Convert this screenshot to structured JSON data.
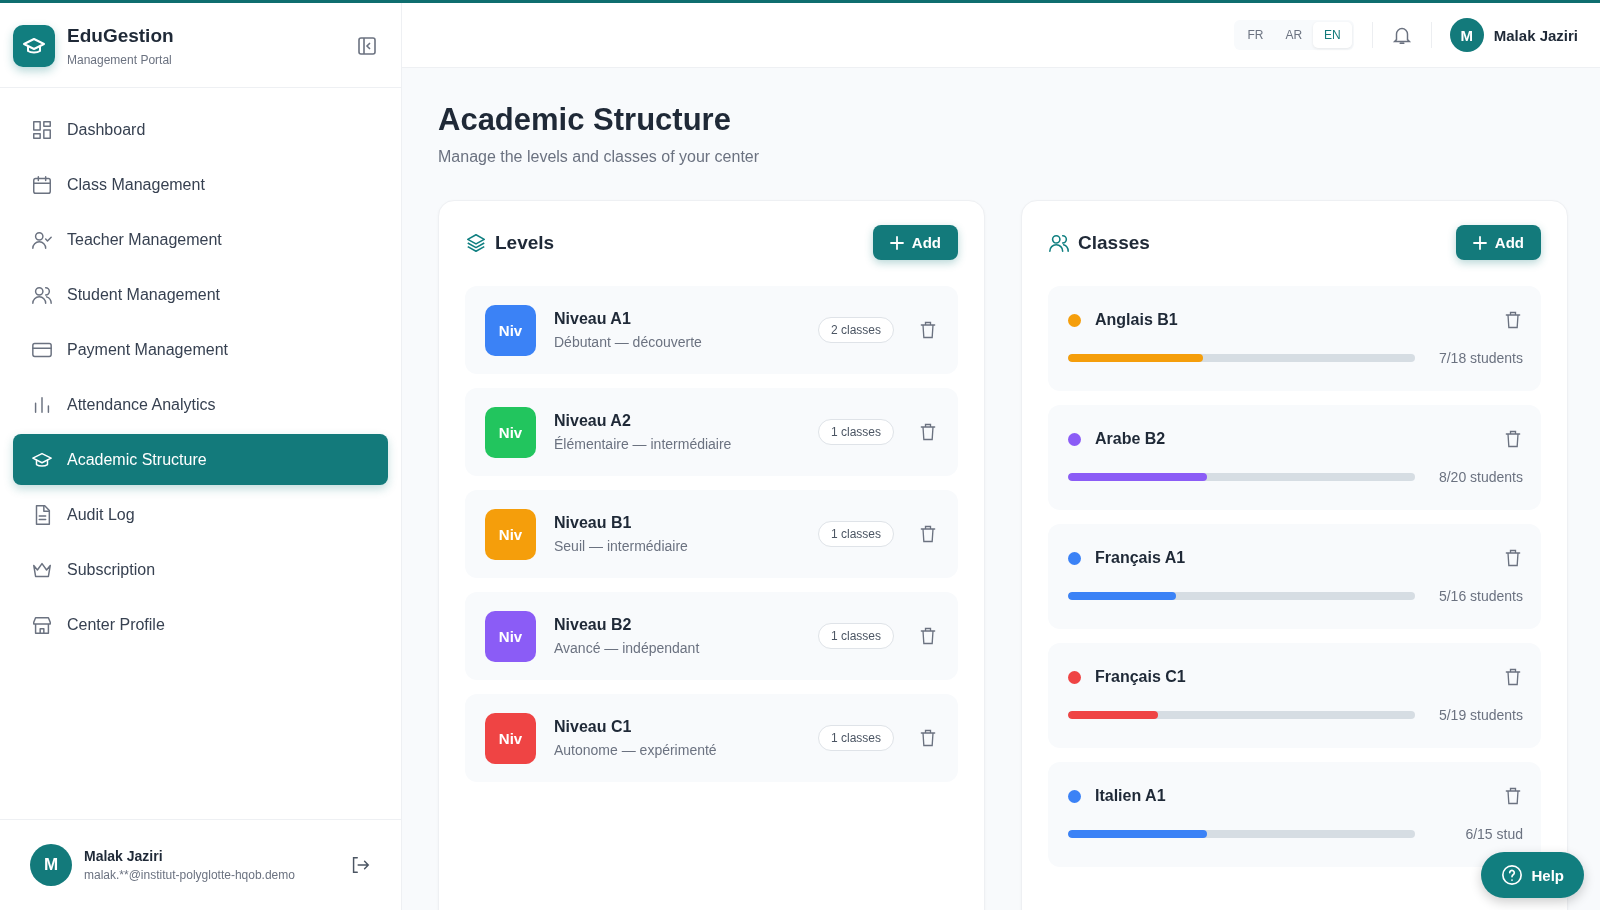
{
  "brand": {
    "name": "EduGestion",
    "subtitle": "Management Portal"
  },
  "nav": [
    {
      "label": "Dashboard",
      "selected": false
    },
    {
      "label": "Class Management",
      "selected": false
    },
    {
      "label": "Teacher Management",
      "selected": false
    },
    {
      "label": "Student Management",
      "selected": false
    },
    {
      "label": "Payment Management",
      "selected": false
    },
    {
      "label": "Attendance Analytics",
      "selected": false
    },
    {
      "label": "Academic Structure",
      "selected": true
    },
    {
      "label": "Audit Log",
      "selected": false
    },
    {
      "label": "Subscription",
      "selected": false
    },
    {
      "label": "Center Profile",
      "selected": false
    }
  ],
  "sidebar_user": {
    "initial": "M",
    "name": "Malak Jaziri",
    "email": "malak.**@institut-polyglotte-hqob.demo"
  },
  "languages": [
    {
      "label": "FR",
      "selected": false
    },
    {
      "label": "AR",
      "selected": false
    },
    {
      "label": "EN",
      "selected": true
    }
  ],
  "header_user": {
    "initial": "M",
    "name": "Malak Jaziri"
  },
  "page": {
    "title": "Academic Structure",
    "subtitle": "Manage the levels and classes of your center"
  },
  "levels": {
    "title": "Levels",
    "add_label": "Add",
    "items": [
      {
        "badge": "Niv",
        "name": "Niveau A1",
        "description": "Débutant — découverte",
        "count": "2 classes",
        "color": "#3b82f6"
      },
      {
        "badge": "Niv",
        "name": "Niveau A2",
        "description": "Élémentaire — intermédiaire",
        "count": "1 classes",
        "color": "#22c55e"
      },
      {
        "badge": "Niv",
        "name": "Niveau B1",
        "description": "Seuil — intermédiaire",
        "count": "1 classes",
        "color": "#f59e0b"
      },
      {
        "badge": "Niv",
        "name": "Niveau B2",
        "description": "Avancé — indépendant",
        "count": "1 classes",
        "color": "#8b5cf6"
      },
      {
        "badge": "Niv",
        "name": "Niveau C1",
        "description": "Autonome — expérimenté",
        "count": "1 classes",
        "color": "#ef4444"
      }
    ]
  },
  "classes": {
    "title": "Classes",
    "add_label": "Add",
    "items": [
      {
        "name": "Anglais B1",
        "color": "#f59e0b",
        "level": 0.39,
        "reading": "7/18 students"
      },
      {
        "name": "Arabe B2",
        "color": "#8b5cf6",
        "level": 0.4,
        "reading": "8/20 students"
      },
      {
        "name": "Français A1",
        "color": "#3b82f6",
        "level": 0.31,
        "reading": "5/16 students"
      },
      {
        "name": "Français C1",
        "color": "#ef4444",
        "level": 0.26,
        "reading": "5/19 students"
      },
      {
        "name": "Italien A1",
        "color": "#3b82f6",
        "level": 0.4,
        "reading": "6/15 stud"
      }
    ]
  },
  "help_label": "Help"
}
